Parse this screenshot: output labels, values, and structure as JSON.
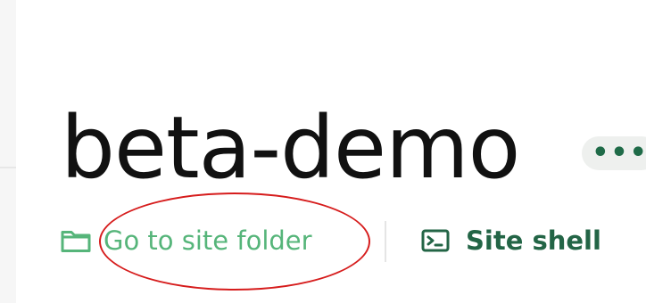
{
  "site": {
    "name": "beta-demo",
    "more_label": "•••"
  },
  "actions": {
    "go_to_folder_label": "Go to site folder",
    "site_shell_label": "Site shell"
  },
  "icons": {
    "folder": "folder-icon",
    "terminal": "terminal-icon",
    "more": "more-icon"
  },
  "colors": {
    "folder_action": "#56b57a",
    "shell_action": "#236546",
    "annotation": "#d61c1c",
    "more_button_bg": "#eef0ee"
  }
}
